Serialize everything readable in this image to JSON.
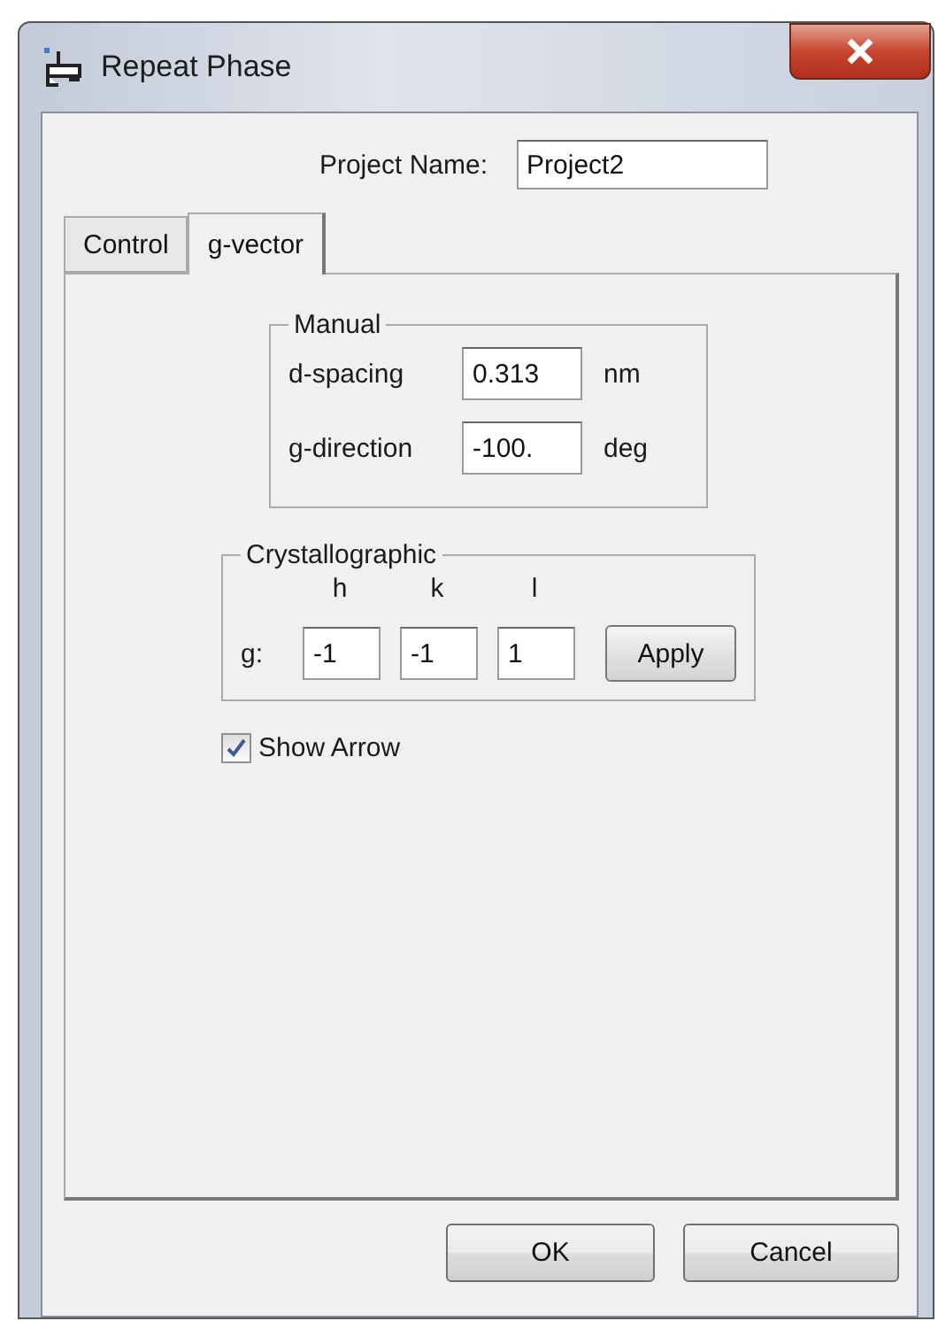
{
  "window": {
    "title": "Repeat Phase"
  },
  "project_name": {
    "label": "Project Name:",
    "value": "Project2"
  },
  "tabs": [
    {
      "label": "Control",
      "selected": false
    },
    {
      "label": "g-vector",
      "selected": true
    }
  ],
  "manual": {
    "title": "Manual",
    "rows": [
      {
        "label": "d-spacing",
        "value": "0.313",
        "unit": "nm"
      },
      {
        "label": "g-direction",
        "value": "-100.",
        "unit": "deg"
      }
    ]
  },
  "crystallographic": {
    "title": "Crystallographic",
    "prefix": "g:",
    "apply": "Apply",
    "indices": [
      {
        "label": "h",
        "value": "-1"
      },
      {
        "label": "k",
        "value": "-1"
      },
      {
        "label": "l",
        "value": "1"
      }
    ]
  },
  "show_arrow": {
    "label": "Show Arrow",
    "checked": true
  },
  "buttons": [
    "OK",
    "Cancel"
  ]
}
